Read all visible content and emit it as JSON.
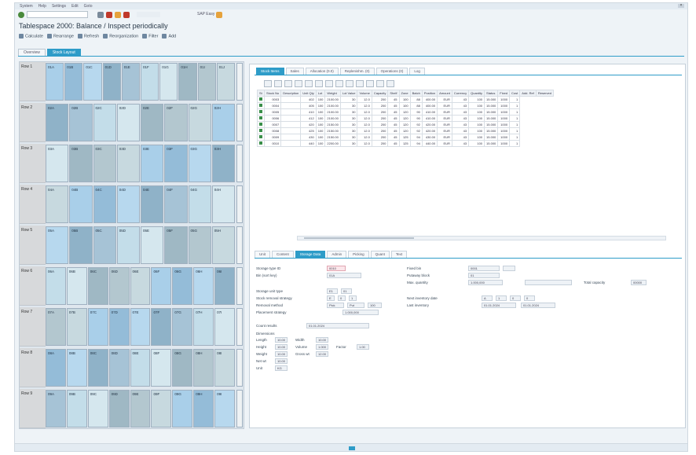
{
  "menubar": {
    "items": [
      "System",
      "Help",
      "Settings",
      "Edit",
      "Goto"
    ]
  },
  "toolbar1": {
    "command_placeholder": "",
    "info_label": "SAP Easy"
  },
  "title": "Tablespace 2000: Balance / Inspect periodically",
  "toolbar2": {
    "items": [
      "Calculate",
      "Rearrange",
      "Refresh",
      "Reorganization",
      "Filter",
      "Add"
    ]
  },
  "main_tabs": [
    {
      "label": "Overview",
      "active": false
    },
    {
      "label": "Stock Layout",
      "active": true
    }
  ],
  "layout_rows": [
    {
      "label": "Row 1",
      "cells": [
        "01A",
        "01B",
        "01C",
        "01D",
        "01E",
        "01F",
        "01G",
        "01H",
        "01I",
        "01J"
      ]
    },
    {
      "label": "Row 2",
      "cells": [
        "02A",
        "02B",
        "02C",
        "02D",
        "02E",
        "02F",
        "02G",
        "02H"
      ]
    },
    {
      "label": "Row 3",
      "cells": [
        "03A",
        "03B",
        "03C",
        "03D",
        "03E",
        "03F",
        "03G",
        "03H"
      ]
    },
    {
      "label": "Row 4",
      "cells": [
        "04A",
        "04B",
        "04C",
        "04D",
        "04E",
        "04F",
        "04G",
        "04H"
      ]
    },
    {
      "label": "Row 5",
      "cells": [
        "05A",
        "05B",
        "05C",
        "05D",
        "05E",
        "05F",
        "05G",
        "05H"
      ]
    },
    {
      "label": "Row 6",
      "cells": [
        "06A",
        "06B",
        "06C",
        "06D",
        "06E",
        "06F",
        "06G",
        "06H",
        "06I"
      ]
    },
    {
      "label": "Row 7",
      "cells": [
        "07A",
        "07B",
        "07C",
        "07D",
        "07E",
        "07F",
        "07G",
        "07H",
        "07I"
      ]
    },
    {
      "label": "Row 8",
      "cells": [
        "08A",
        "08B",
        "08C",
        "08D",
        "08E",
        "08F",
        "08G",
        "08H",
        "08I"
      ]
    },
    {
      "label": "Row 9",
      "cells": [
        "09A",
        "09B",
        "09C",
        "09D",
        "09E",
        "09F",
        "09G",
        "09H",
        "09I"
      ]
    }
  ],
  "right_tabs": [
    {
      "label": "Stock Items",
      "active": true
    },
    {
      "label": "Sales",
      "active": false
    },
    {
      "label": "Allocation (0.0)",
      "active": false
    },
    {
      "label": "Replenishm. (0)",
      "active": false
    },
    {
      "label": "Operations (0)",
      "active": false
    },
    {
      "label": "Log",
      "active": false
    }
  ],
  "table": {
    "headers": [
      "St",
      "Stock No",
      "Description",
      "Unit Qty",
      "Lot",
      "Weight",
      "Lot Value",
      "Volume",
      "Capacity",
      "Shelf",
      "Zone",
      "Batch",
      "Position",
      "Amount",
      "Currency",
      "Quantity",
      "Status",
      "Fixed",
      "Cost",
      "Add. Ref",
      "Reserved"
    ],
    "rows": [
      [
        "",
        "0003",
        "",
        "402",
        "100",
        "2100.00",
        "30",
        "12.0",
        "200",
        "45",
        "100",
        "88",
        "400.00",
        "EUR",
        "43",
        "100",
        "15.000",
        "1000",
        "1"
      ],
      [
        "",
        "0004",
        "",
        "405",
        "100",
        "2100.00",
        "30",
        "12.0",
        "200",
        "45",
        "100",
        "88",
        "400.00",
        "EUR",
        "43",
        "100",
        "15.000",
        "1000",
        "1"
      ],
      [
        "",
        "0005",
        "",
        "410",
        "100",
        "2100.00",
        "30",
        "12.0",
        "200",
        "45",
        "120",
        "90",
        "410.00",
        "EUR",
        "43",
        "100",
        "15.000",
        "1000",
        "1"
      ],
      [
        "",
        "0006",
        "",
        "412",
        "100",
        "2100.00",
        "30",
        "12.0",
        "200",
        "45",
        "120",
        "90",
        "410.00",
        "EUR",
        "43",
        "100",
        "15.000",
        "1000",
        "1"
      ],
      [
        "",
        "0007",
        "",
        "420",
        "100",
        "2150.00",
        "30",
        "12.0",
        "200",
        "45",
        "120",
        "92",
        "420.00",
        "EUR",
        "43",
        "100",
        "15.000",
        "1000",
        "1"
      ],
      [
        "",
        "0008",
        "",
        "425",
        "100",
        "2150.00",
        "30",
        "12.0",
        "200",
        "45",
        "120",
        "92",
        "420.00",
        "EUR",
        "43",
        "100",
        "15.000",
        "1000",
        "1"
      ],
      [
        "",
        "0009",
        "",
        "430",
        "100",
        "2150.00",
        "30",
        "12.0",
        "200",
        "45",
        "125",
        "94",
        "430.00",
        "EUR",
        "43",
        "100",
        "15.000",
        "1000",
        "1"
      ],
      [
        "",
        "0010",
        "",
        "440",
        "100",
        "2200.00",
        "30",
        "12.0",
        "200",
        "45",
        "125",
        "94",
        "440.00",
        "EUR",
        "43",
        "100",
        "15.000",
        "1000",
        "1"
      ]
    ]
  },
  "bottom_tabs": [
    {
      "label": "Unit",
      "active": false
    },
    {
      "label": "Content",
      "active": false
    },
    {
      "label": "Storage Data",
      "active": true
    },
    {
      "label": "Admin",
      "active": false
    },
    {
      "label": "Picking",
      "active": false
    },
    {
      "label": "Quant",
      "active": false
    },
    {
      "label": "Text",
      "active": false
    }
  ],
  "form": {
    "storage_type_label": "Storage type ID",
    "storage_type_value": "0010",
    "bin_label": "Bin (sort key)",
    "bin_value": "01A",
    "fixed_bin_label": "Fixed bin",
    "fixed_bin_value": "0001",
    "putaway_label": "Putaway block",
    "putaway_value": "01",
    "max_qty_label": "Max. quantity",
    "max_qty_value": "1.000,000",
    "total_capacity_label": "Total capacity",
    "total_capacity_value": "00000",
    "storage_unit_label": "Storage unit type",
    "storage_unit_values": [
      "E1",
      "01"
    ],
    "stock_removal_label": "Stock removal strategy",
    "stock_removal_values": [
      "E",
      "0",
      "1"
    ],
    "rem_label": "Removal method",
    "rem_values": [
      "Pick",
      "Put",
      "100"
    ],
    "placement_label": "Placement strategy",
    "placement_value": "1.000,000",
    "next_label": "Next inventory date",
    "next_values": [
      "A",
      "1",
      "0",
      "0"
    ],
    "last_label": "Last inventory",
    "last_values": [
      "01.01.2024",
      "01.01.2024"
    ],
    "count_label": "Count results",
    "count_value": "01.01.2024",
    "dim_label": "Dimensions",
    "dim_items": [
      {
        "label": "Length",
        "value": "10.00"
      },
      {
        "label": "Width",
        "value": "10.00"
      },
      {
        "label": "Height",
        "value": "10.00"
      },
      {
        "label": "Volume",
        "value": "1.000"
      },
      {
        "label": "Weight",
        "value": "10.00"
      },
      {
        "label": "Gross wt",
        "value": "12.00"
      },
      {
        "label": "Net wt",
        "value": "10.00"
      },
      {
        "label": "Unit",
        "value": "KG"
      }
    ],
    "extra_label": "Factor",
    "extra_value": "1.00"
  }
}
